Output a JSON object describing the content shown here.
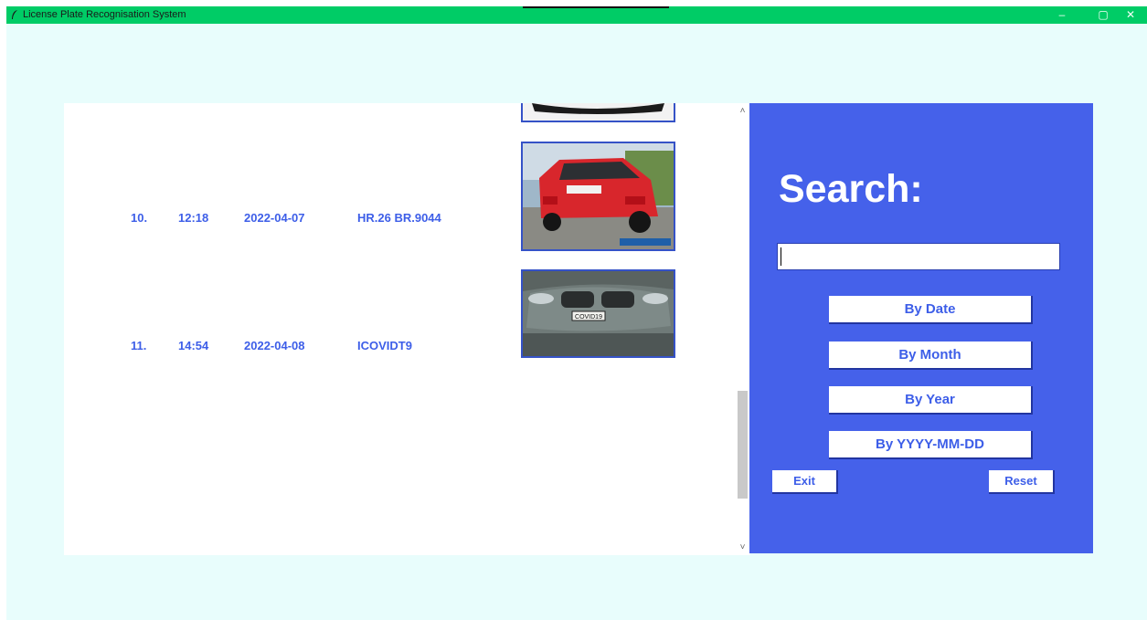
{
  "window": {
    "title": "License Plate Recognisation System",
    "controls": {
      "minimize": "–",
      "maximize": "▢",
      "close": "✕"
    }
  },
  "records": [
    {
      "index": "10.",
      "time": "12:18",
      "date": "2022-04-07",
      "plate": "HR.26 BR.9044",
      "image": "red-mini-cooper-rear"
    },
    {
      "index": "11.",
      "time": "14:54",
      "date": "2022-04-08",
      "plate": "ICOVIDT9",
      "image": "grey-bmw-front",
      "image_plate_text": "COVID19"
    }
  ],
  "search": {
    "title": "Search:",
    "input_value": "",
    "buttons": {
      "by_date": "By Date",
      "by_month": "By Month",
      "by_year": "By Year",
      "by_full_date": "By YYYY-MM-DD"
    },
    "exit": "Exit",
    "reset": "Reset"
  },
  "scrollbar": {
    "up": "˄",
    "down": "˅"
  },
  "colors": {
    "titlebar": "#00cc66",
    "background": "#e8fdfc",
    "panel": "#4561ea",
    "accent_text": "#3d5ee8"
  }
}
